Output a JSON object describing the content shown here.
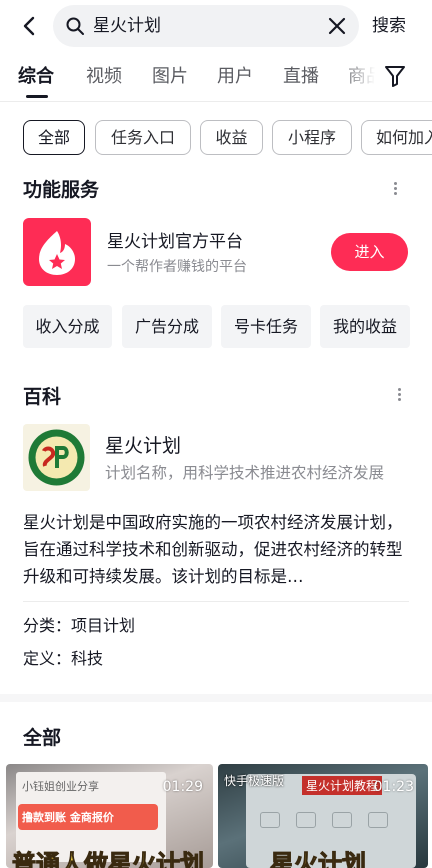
{
  "search": {
    "query": "星火计划",
    "search_label": "搜索"
  },
  "tabs": [
    {
      "label": "综合",
      "active": true
    },
    {
      "label": "视频"
    },
    {
      "label": "图片"
    },
    {
      "label": "用户"
    },
    {
      "label": "直播"
    },
    {
      "label": "商品"
    }
  ],
  "chips": [
    {
      "label": "全部",
      "active": true
    },
    {
      "label": "任务入口"
    },
    {
      "label": "收益"
    },
    {
      "label": "小程序"
    },
    {
      "label": "如何加入"
    }
  ],
  "services": {
    "title": "功能服务",
    "app_name": "星火计划官方平台",
    "app_desc": "一个帮作者赚钱的平台",
    "enter_label": "进入",
    "buttons": [
      "收入分成",
      "广告分成",
      "号卡任务",
      "我的收益"
    ]
  },
  "baike": {
    "title": "百科",
    "name": "星火计划",
    "subtitle": "计划名称，用科学技术推进农村经济发展",
    "body": "星火计划是中国政府实施的一项农村经济发展计划，旨在通过科学技术和创新驱动，促进农村经济的转型升级和可持续发展。该计划的目标是…",
    "category": "分类：项目计划",
    "definition": "定义：科技"
  },
  "all_section": {
    "title": "全部",
    "videos": [
      {
        "duration": "01:29",
        "author": "小钰姐创业分享",
        "overlay": "普通人做星火计划",
        "pill": "撸款到账 金商报价"
      },
      {
        "duration": "01:23",
        "app": "快手极速版",
        "tag": "星火计划教程",
        "overlay": "星火计划"
      }
    ]
  },
  "colors": {
    "accent": "#fe2c55",
    "text": "#161823",
    "muted": "#8a8b91"
  }
}
